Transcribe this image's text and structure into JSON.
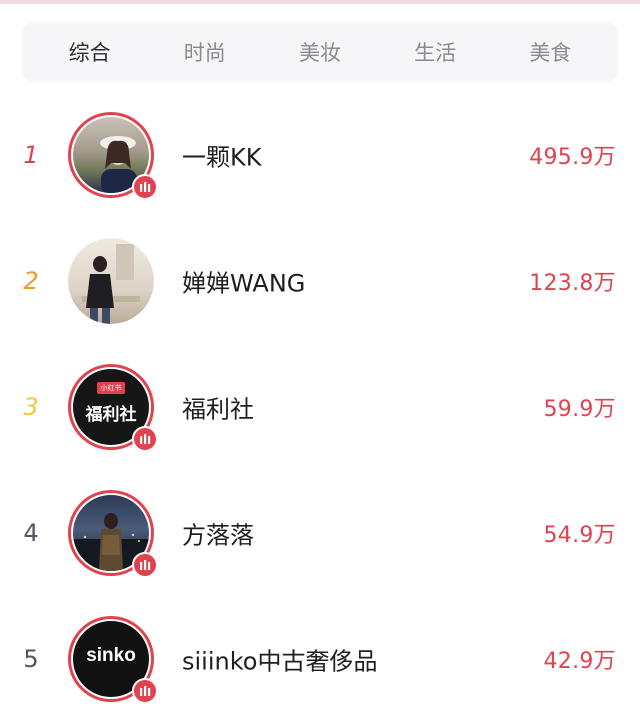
{
  "tabs": [
    {
      "label": "综合",
      "active": true
    },
    {
      "label": "时尚",
      "active": false
    },
    {
      "label": "美妆",
      "active": false
    },
    {
      "label": "生活",
      "active": false
    },
    {
      "label": "美食",
      "active": false
    }
  ],
  "ranking": [
    {
      "rank": "1",
      "name": "一颗KK",
      "count": "495.9万"
    },
    {
      "rank": "2",
      "name": "婵婵WANG",
      "count": "123.8万"
    },
    {
      "rank": "3",
      "name": "福利社",
      "count": "59.9万",
      "logo_tag": "小红书",
      "logo_text": "福利社"
    },
    {
      "rank": "4",
      "name": "方落落",
      "count": "54.9万"
    },
    {
      "rank": "5",
      "name": "siiinko中古奢侈品",
      "count": "42.9万",
      "logo_text": "sinko"
    }
  ],
  "colors": {
    "accent": "#e0424f",
    "rank2": "#f39a2a",
    "rank3": "#f5c53a"
  }
}
